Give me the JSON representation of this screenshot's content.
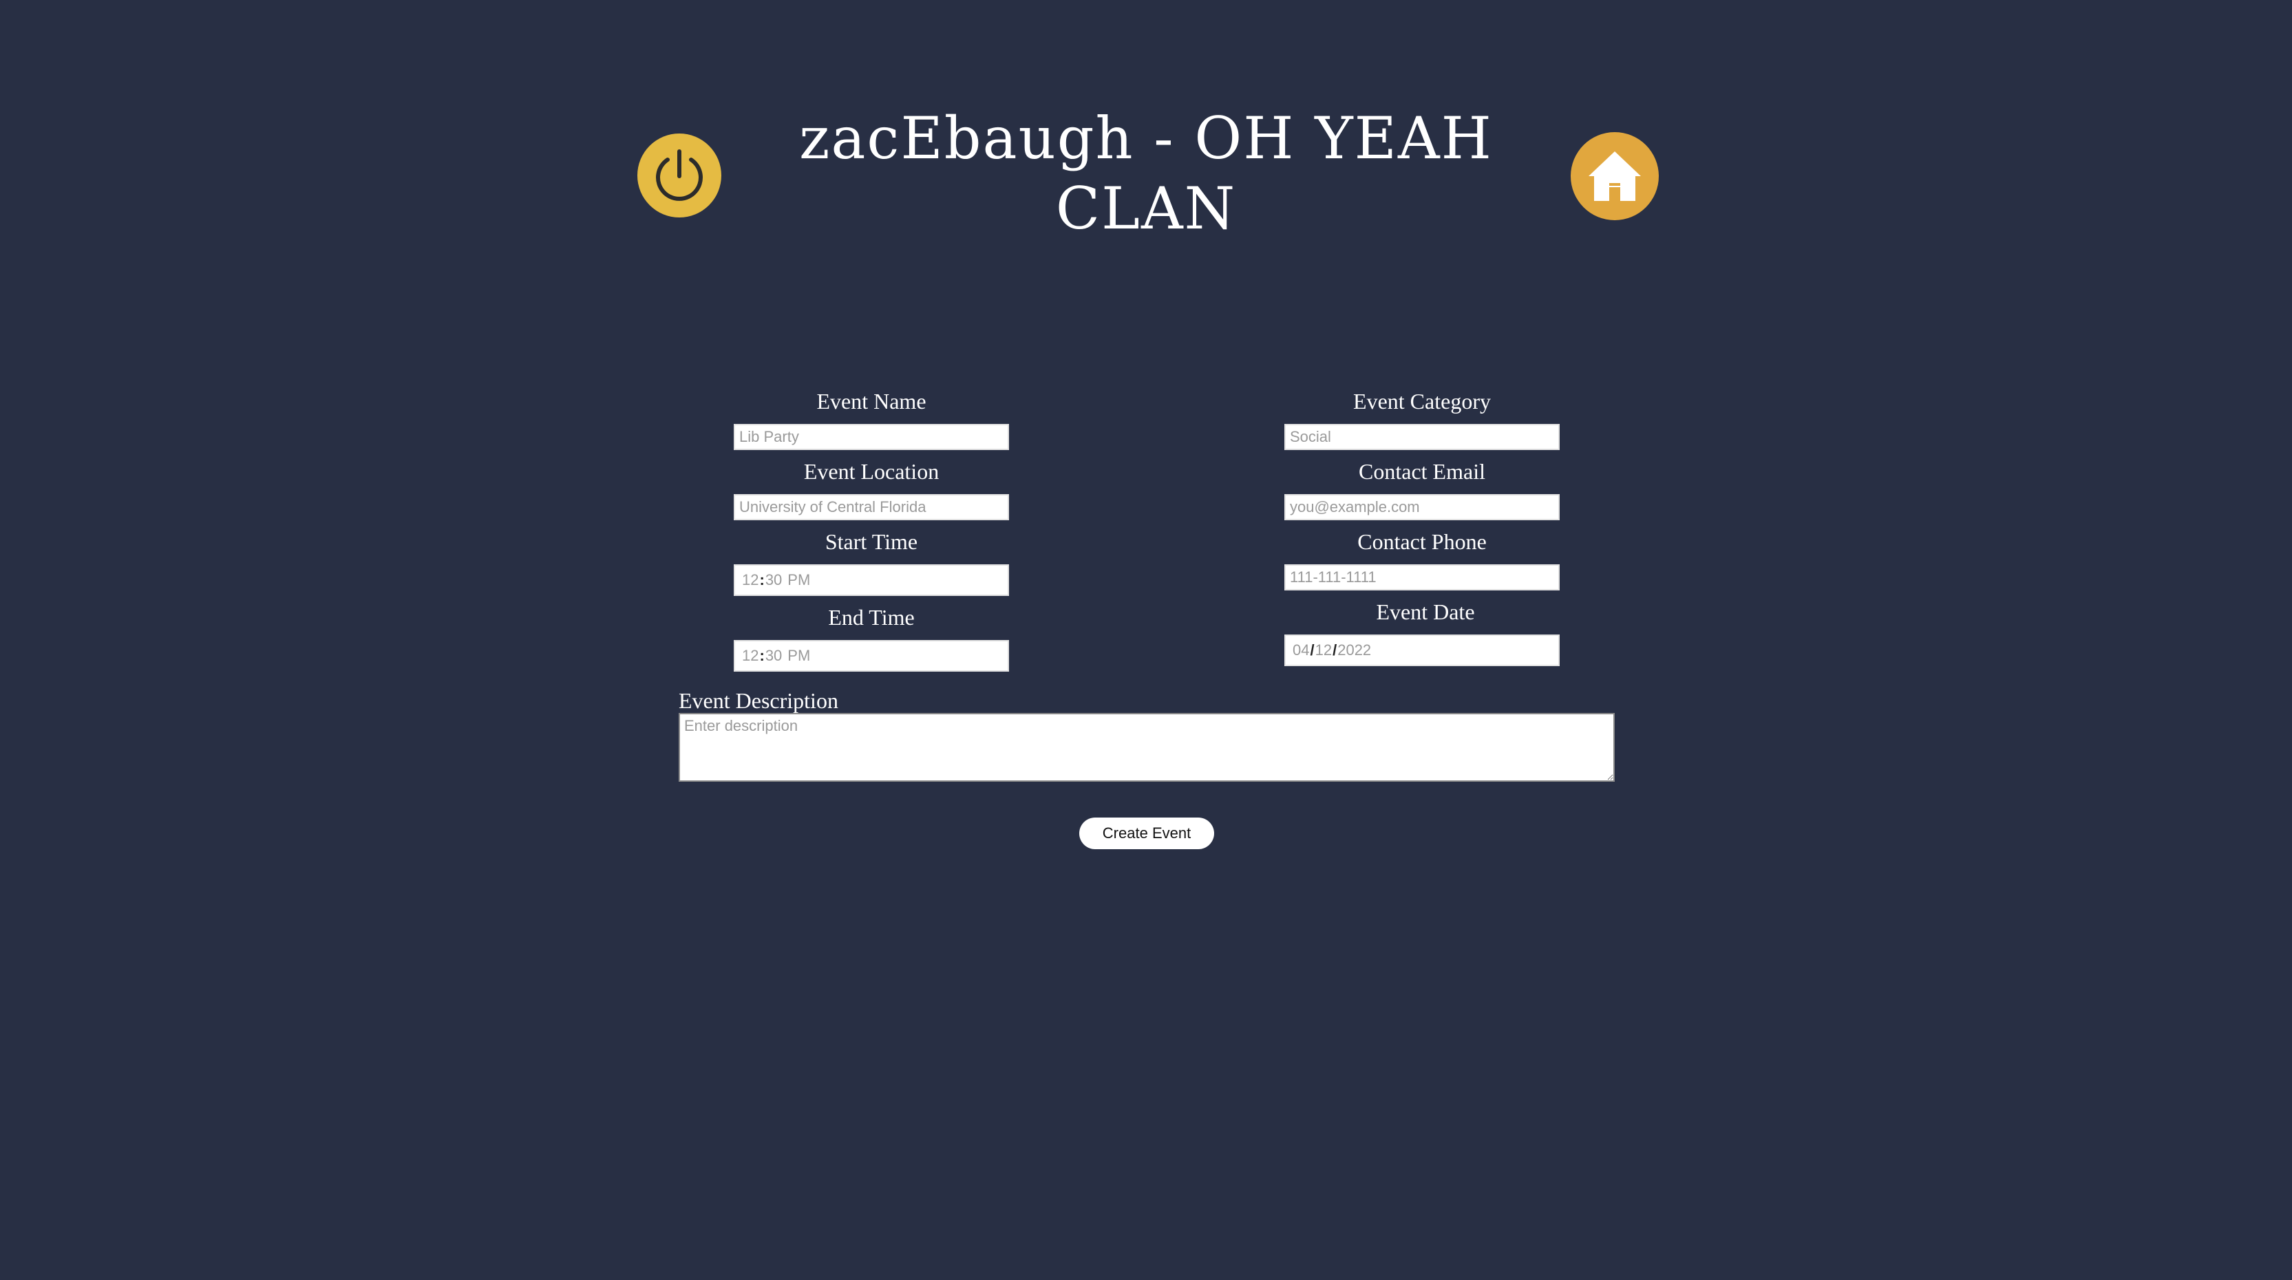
{
  "header": {
    "title": "zacEbaugh - OH YEAH CLAN",
    "logout_icon": "power-icon",
    "home_icon": "home-icon",
    "accent_colors": {
      "logout": "#e5bb43",
      "home": "#e1a73e"
    }
  },
  "form": {
    "event_name": {
      "label": "Event Name",
      "placeholder": "Lib Party"
    },
    "event_category": {
      "label": "Event Category",
      "placeholder": "Social"
    },
    "event_location": {
      "label": "Event Location",
      "placeholder": "University of Central Florida"
    },
    "contact_email": {
      "label": "Contact Email",
      "placeholder": "you@example.com"
    },
    "start_time": {
      "label": "Start Time",
      "hour": "12",
      "minute": "30",
      "period": "PM"
    },
    "contact_phone": {
      "label": "Contact Phone",
      "placeholder": "111-111-1111"
    },
    "end_time": {
      "label": "End Time",
      "hour": "12",
      "minute": "30",
      "period": "PM"
    },
    "event_date": {
      "label": "Event Date",
      "month": "04",
      "day": "12",
      "year": "2022"
    },
    "event_description": {
      "label": "Event Description",
      "placeholder": "Enter description"
    },
    "submit_label": "Create Event"
  },
  "colors": {
    "background": "#282f44",
    "text": "#ffffff"
  }
}
